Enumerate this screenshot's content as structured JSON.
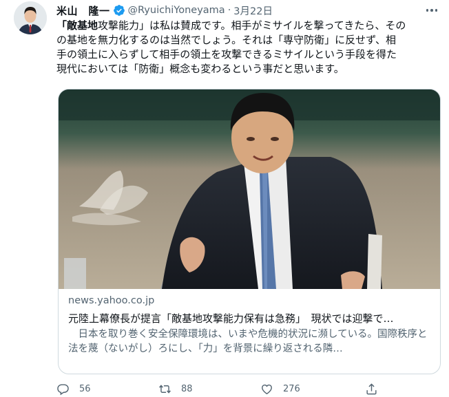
{
  "tweet": {
    "display_name": "米山　隆一",
    "handle": "@RyuichiYoneyama",
    "separator": "·",
    "date": "3月22日",
    "text_lines": [
      {
        "bold": "「敵基地",
        "rest": "攻撃能力」は私は賛成です。相手がミサイルを撃ってきたら、その"
      },
      {
        "bold": "",
        "rest": "の基地を無力化するのは当然でしょう。それは「専守防衛」に反せず、相"
      },
      {
        "bold": "",
        "rest": "手の領土に入らずして相手の領土を攻撃できるミサイルという手段を得た"
      },
      {
        "bold": "",
        "rest": "現代においては「防衛」概念も変わるという事だと思います。"
      }
    ]
  },
  "card": {
    "domain": "news.yahoo.co.jp",
    "title": "元陸上幕僚長が提言「敵基地攻撃能力保有は急務」　現状では迎撃で…",
    "description": "日本を取り巻く安全保障環境は、いまや危機的状況に瀕している。国際秩序と法を蔑（ないがし）ろにし、「力」を背景に繰り返される隣…"
  },
  "actions": {
    "reply_count": "56",
    "retweet_count": "88",
    "like_count": "276",
    "share_count": ""
  },
  "icons": {
    "verified": "verified-badge-icon",
    "more": "more-dots-icon",
    "reply": "reply-icon",
    "retweet": "retweet-icon",
    "like": "heart-icon",
    "share": "share-icon"
  },
  "colors": {
    "verified": "#1d9bf0",
    "text": "#0f1419",
    "secondary": "#536471",
    "border": "#cfd9de"
  }
}
